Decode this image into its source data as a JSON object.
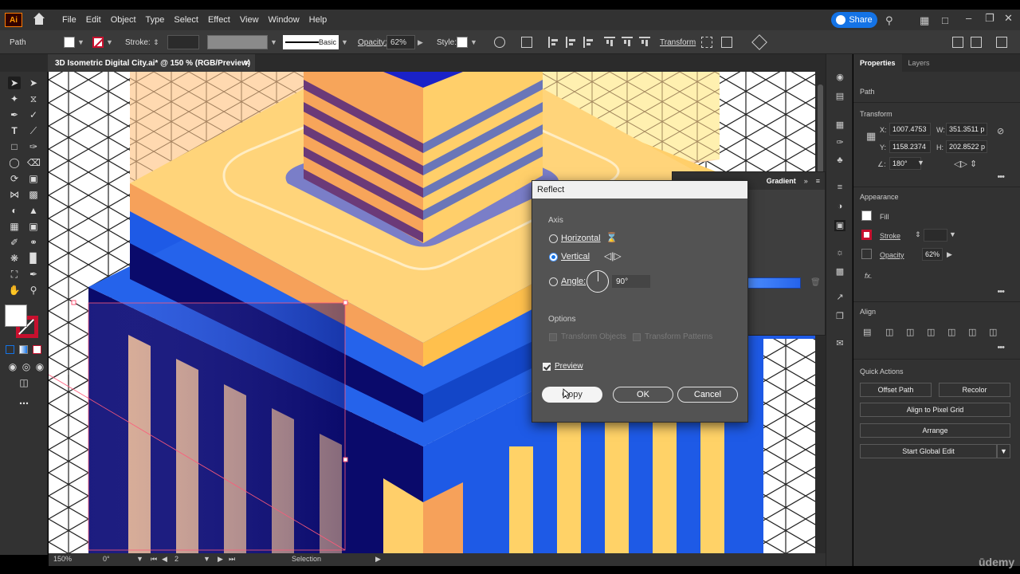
{
  "app": {
    "logo": "Ai"
  },
  "menu": [
    "File",
    "Edit",
    "Object",
    "Type",
    "Select",
    "Effect",
    "View",
    "Window",
    "Help"
  ],
  "share_label": "Share",
  "control": {
    "object_type": "Path",
    "stroke_label": "Stroke:",
    "brush_label": "Basic",
    "opacity_label": "Opacity:",
    "opacity_value": "62%",
    "style_label": "Style:",
    "transform_label": "Transform"
  },
  "document": {
    "tab_title": "3D Isometric Digital City.ai* @ 150 % (RGB/Preview)",
    "close": "✕"
  },
  "status": {
    "zoom": "150%",
    "rotation": "0°",
    "artboard": "2",
    "tool": "Selection"
  },
  "gradient_panel": {
    "title": "Gradient"
  },
  "reflect": {
    "title": "Reflect",
    "axis_label": "Axis",
    "horizontal_label": "Horizontal",
    "vertical_label": "Vertical",
    "angle_label": "Angle:",
    "angle_value": "90°",
    "options_label": "Options",
    "transform_objects": "Transform Objects",
    "transform_patterns": "Transform Patterns",
    "preview_label": "Preview",
    "copy_label": "Copy",
    "ok_label": "OK",
    "cancel_label": "Cancel",
    "selected_axis": "vertical",
    "preview_checked": true
  },
  "properties": {
    "tabs": [
      "Properties",
      "Layers"
    ],
    "object_type": "Path",
    "transform_label": "Transform",
    "x_label": "X:",
    "x_value": "1007.4753",
    "y_label": "Y:",
    "y_value": "1158.2374",
    "w_label": "W:",
    "w_value": "351.3511 p",
    "h_label": "H:",
    "h_value": "202.8522 p",
    "angle_label": "∠:",
    "angle_value": "180°",
    "appearance_label": "Appearance",
    "fill_label": "Fill",
    "stroke_label": "Stroke",
    "opacity_label": "Opacity",
    "opacity_value": "62%",
    "fx_label": "fx.",
    "align_label": "Align",
    "quick_actions_label": "Quick Actions",
    "offset_path": "Offset Path",
    "recolor": "Recolor",
    "align_pixel_grid": "Align to Pixel Grid",
    "arrange": "Arrange",
    "global_edit": "Start Global Edit"
  },
  "watermark": "ūdemy",
  "colors": {
    "accent": "#1473e6",
    "navy": "#0a0a6b",
    "blue": "#1e5ae6",
    "orange": "#f6a15a",
    "yellow": "#ffd267",
    "peach": "#ffcf9a"
  }
}
